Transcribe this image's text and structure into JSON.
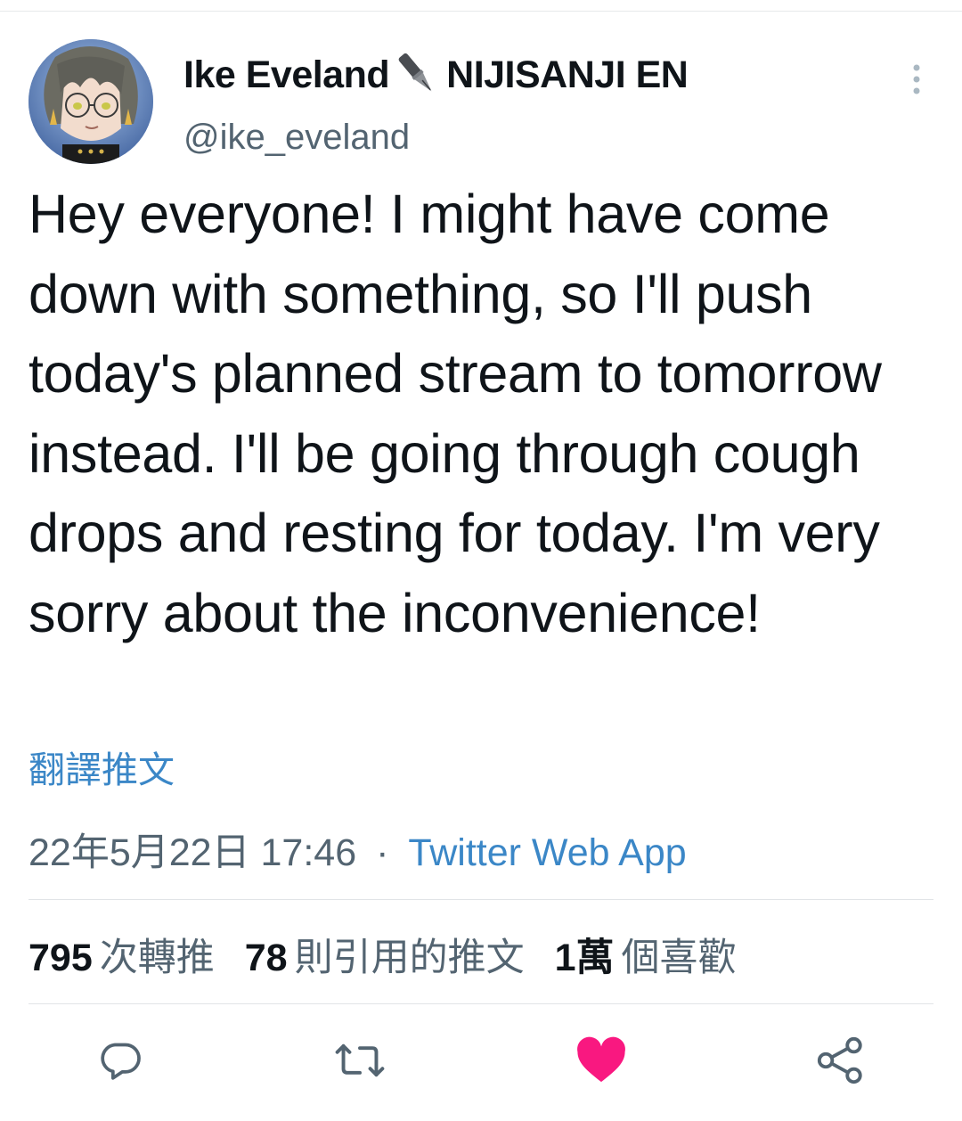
{
  "author": {
    "name_part1": "Ike Eveland",
    "name_part2": "NIJISANJI EN",
    "handle": "@ike_eveland"
  },
  "tweet": {
    "text": "Hey everyone! I might have come down with something, so I'll push today's planned stream to tomorrow instead. I'll be going through cough drops and resting for today. I'm very sorry about the inconvenience!",
    "translate_label": "翻譯推文"
  },
  "meta": {
    "timestamp": "22年5月22日 17:46",
    "separator": "·",
    "source": "Twitter Web App"
  },
  "stats": {
    "retweets_count": "795",
    "retweets_label": "次轉推",
    "quotes_count": "78",
    "quotes_label": "則引用的推文",
    "likes_count": "1萬",
    "likes_label": "個喜歡"
  },
  "actions": {
    "reply_icon": "reply-icon",
    "retweet_icon": "retweet-icon",
    "like_icon": "heart-icon",
    "like_color": "#f91880",
    "share_icon": "share-icon"
  },
  "colors": {
    "link": "#3b87c7",
    "secondary_text": "#536471",
    "primary_text": "#0f1419"
  }
}
